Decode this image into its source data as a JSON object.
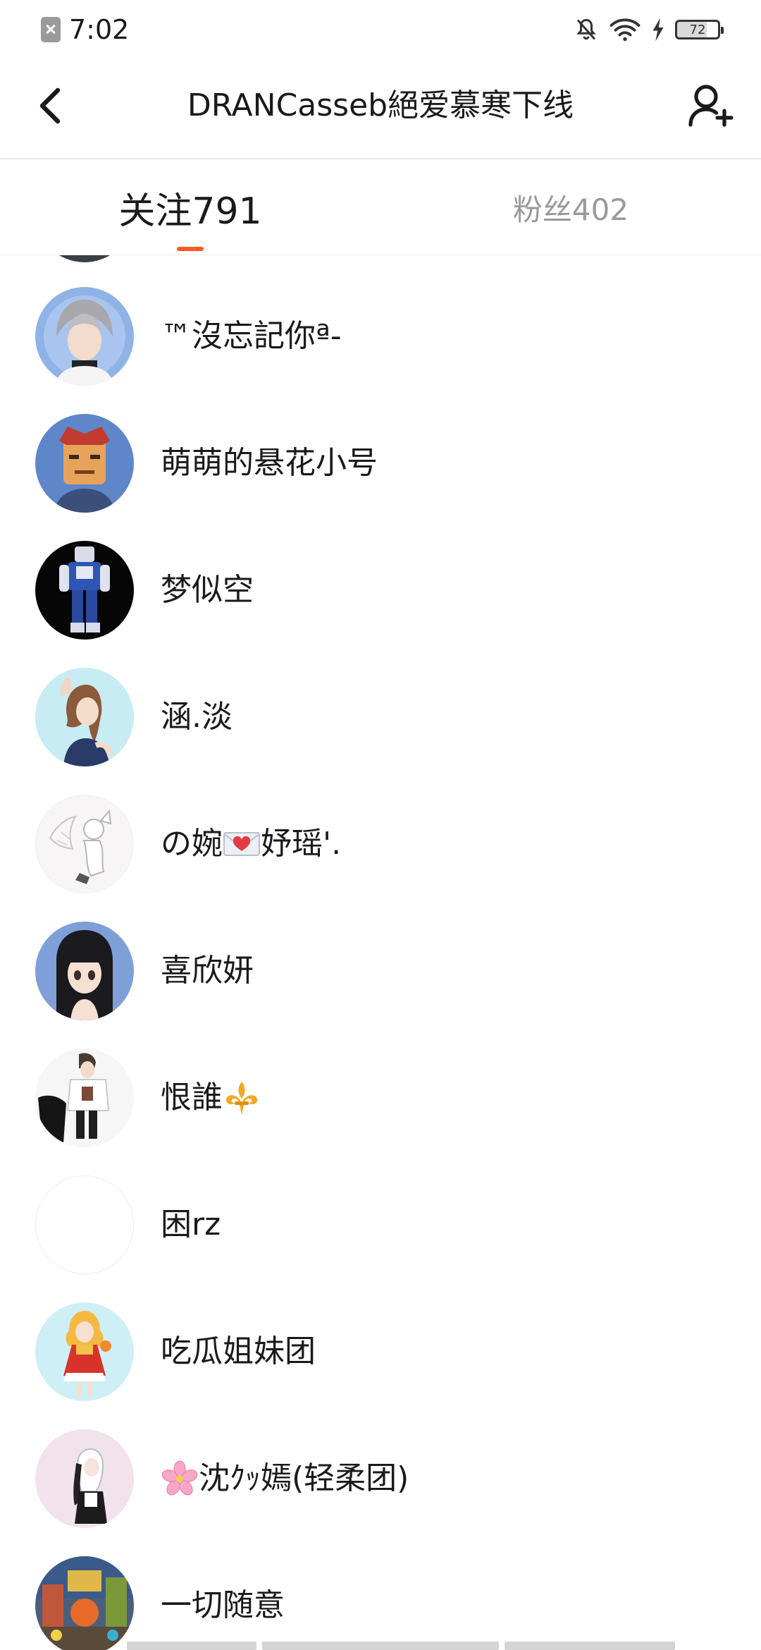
{
  "status_bar": {
    "time": "7:02",
    "battery": "72",
    "icons": [
      "sim-off-icon",
      "bell-off-icon",
      "wifi-icon",
      "charging-icon",
      "battery-icon"
    ]
  },
  "nav": {
    "title": "DRANCasseb絕爱慕寒下线",
    "back_icon": "chevron-left-icon",
    "add_user_icon": "add-user-icon"
  },
  "tabs": {
    "following_label": "关注791",
    "followers_label": "粉丝402",
    "active": "following",
    "accent_color": "#ff5722"
  },
  "users": [
    {
      "name": "™沒忘記你ª-",
      "avatar": "gray-haired-anime-boy",
      "emoji": ""
    },
    {
      "name": "萌萌的悬花小号",
      "avatar": "armored-hero",
      "emoji": ""
    },
    {
      "name": "梦似空",
      "avatar": "robot-on-black",
      "emoji": ""
    },
    {
      "name": "涵.淡",
      "avatar": "waving-girl",
      "emoji": ""
    },
    {
      "name": "の婉",
      "avatar": "fox-sketch",
      "emoji": "love-letter-icon",
      "suffix": "妤瑶'."
    },
    {
      "name": "喜欣妍",
      "avatar": "black-haired-girl",
      "emoji": ""
    },
    {
      "name": "恨誰",
      "avatar": "figure-white-shirt",
      "emoji": "fleur-de-lis-icon"
    },
    {
      "name": "困rz",
      "avatar": "blank-white",
      "emoji": ""
    },
    {
      "name": "吃瓜姐妹团",
      "avatar": "girl-red-dress",
      "emoji": ""
    },
    {
      "name": "沈ｸｯ嫣(轻柔团)",
      "avatar": "monochrome-girl",
      "emoji": "cherry-blossom-icon",
      "emoji_position": "prefix"
    },
    {
      "name": "一切随意",
      "avatar": "colorful-street",
      "emoji": ""
    }
  ]
}
